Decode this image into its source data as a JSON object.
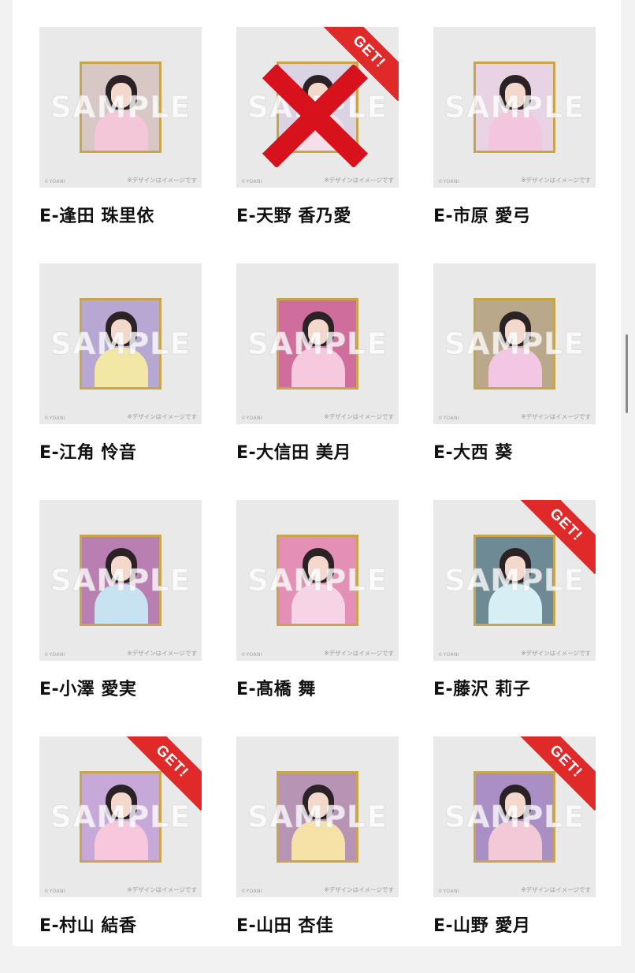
{
  "watermark": "SAMPLE",
  "copyright": "©YOANI",
  "design_note": "※デザインはイメージです",
  "badge_label": "GET!",
  "colors": {
    "badge": "#e02a2a",
    "cross": "#d8121c",
    "frame_gold": "#c9a54a",
    "page_bg": "#f2f2f2"
  },
  "items": [
    {
      "name": "E-逢田 珠里依",
      "got": false,
      "crossed": false,
      "bg": "#d7c8c6",
      "outfit": "#f4c7d8"
    },
    {
      "name": "E-天野 香乃愛",
      "got": true,
      "crossed": true,
      "bg": "#d9d3e3",
      "outfit": "#f6dfe9"
    },
    {
      "name": "E-市原 愛弓",
      "got": false,
      "crossed": false,
      "bg": "#e7d3e3",
      "outfit": "#f3c6dd"
    },
    {
      "name": "E-江角 怜音",
      "got": false,
      "crossed": false,
      "bg": "#b6a7d3",
      "outfit": "#f2e7a4"
    },
    {
      "name": "E-大信田 美月",
      "got": false,
      "crossed": false,
      "bg": "#cf6e9c",
      "outfit": "#f7c9df"
    },
    {
      "name": "E-大西 葵",
      "got": false,
      "crossed": false,
      "bg": "#b9a98a",
      "outfit": "#f3c6e3"
    },
    {
      "name": "E-小澤 愛実",
      "got": false,
      "crossed": false,
      "bg": "#b97fb3",
      "outfit": "#c7e2f0"
    },
    {
      "name": "E-髙橋 舞",
      "got": false,
      "crossed": false,
      "bg": "#e490b6",
      "outfit": "#f7d3e6"
    },
    {
      "name": "E-藤沢 莉子",
      "got": true,
      "crossed": false,
      "bg": "#6e8a95",
      "outfit": "#d7eef5"
    },
    {
      "name": "E-村山 結香",
      "got": true,
      "crossed": false,
      "bg": "#c6a8d9",
      "outfit": "#f7c8dd"
    },
    {
      "name": "E-山田 杏佳",
      "got": false,
      "crossed": false,
      "bg": "#b793b4",
      "outfit": "#f6e2a6"
    },
    {
      "name": "E-山野 愛月",
      "got": true,
      "crossed": false,
      "bg": "#a98fc3",
      "outfit": "#f3c9d8"
    }
  ]
}
